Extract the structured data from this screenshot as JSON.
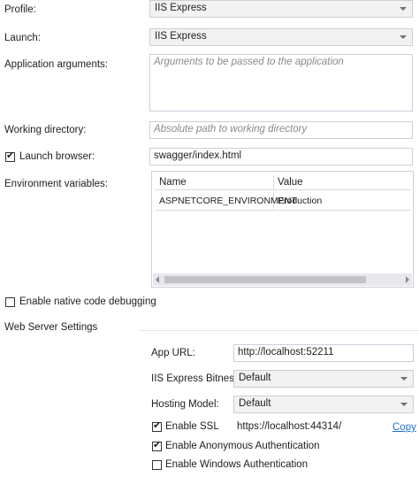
{
  "profile": {
    "label": "Profile:",
    "value": "IIS Express"
  },
  "launch": {
    "label": "Launch:",
    "value": "IIS Express"
  },
  "app_args": {
    "label": "Application arguments:",
    "placeholder": "Arguments to be passed to the application"
  },
  "working_dir": {
    "label": "Working directory:",
    "placeholder": "Absolute path to working directory"
  },
  "launch_browser": {
    "label": "Launch browser:",
    "checked": true,
    "value": "swagger/index.html"
  },
  "env_vars": {
    "label": "Environment variables:",
    "columns": [
      "Name",
      "Value"
    ],
    "rows": [
      {
        "name": "ASPNETCORE_ENVIRONMENT",
        "value": "Production"
      }
    ]
  },
  "native_debug": {
    "label": "Enable native code debugging",
    "checked": false
  },
  "web_server": {
    "heading": "Web Server Settings",
    "app_url": {
      "label": "App URL:",
      "value": "http://localhost:52211"
    },
    "bitness": {
      "label": "IIS Express Bitness:",
      "value": "Default"
    },
    "hosting_model": {
      "label": "Hosting Model:",
      "value": "Default"
    },
    "ssl": {
      "label": "Enable SSL",
      "checked": true,
      "url": "https://localhost:44314/",
      "copy_label": "Copy"
    },
    "anon_auth": {
      "label": "Enable Anonymous Authentication",
      "checked": true
    },
    "windows_auth": {
      "label": "Enable Windows Authentication",
      "checked": false
    }
  }
}
